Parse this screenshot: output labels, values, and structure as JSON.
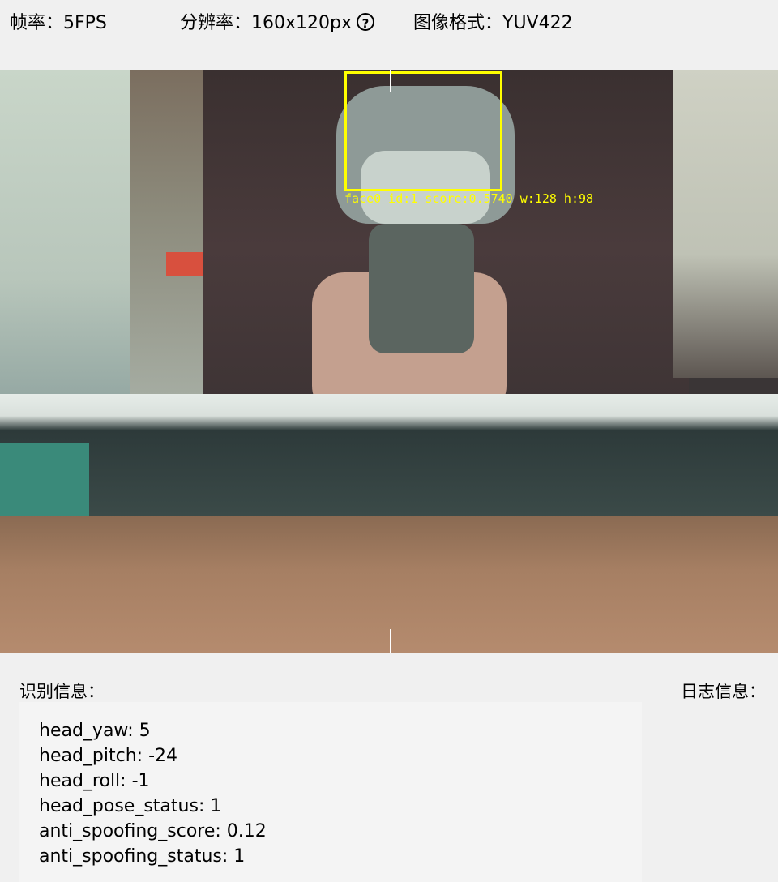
{
  "header": {
    "fps_label": "帧率：",
    "fps_value": "5FPS",
    "resolution_label": "分辨率：",
    "resolution_value": "160x120px",
    "help_glyph": "?",
    "format_label": "图像格式：",
    "format_value": "YUV422"
  },
  "camera": {
    "detection_text": "face0 id:1 score:0.5740 w:128 h:98",
    "box_color": "#ffff00"
  },
  "recognition": {
    "title": "识别信息：",
    "lines": [
      "head_yaw: 5",
      "head_pitch: -24",
      "head_roll: -1",
      "head_pose_status: 1",
      "anti_spoofing_score: 0.12",
      "anti_spoofing_status: 1"
    ]
  },
  "log": {
    "title": "日志信息："
  }
}
